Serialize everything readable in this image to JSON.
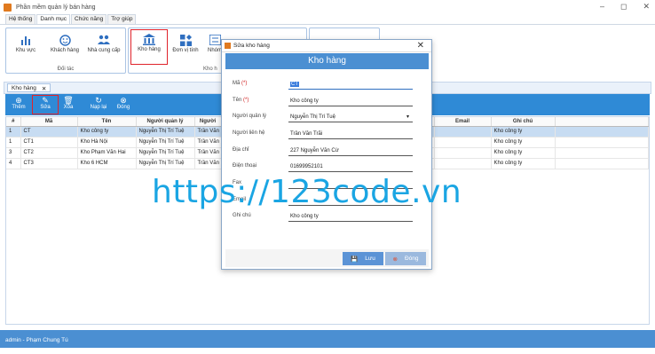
{
  "window": {
    "title": "Phần mềm quản lý bán hàng",
    "ctrls": [
      "–",
      "◻",
      "✕"
    ]
  },
  "menu": [
    "Hệ thống",
    "Danh mục",
    "Chức năng",
    "Trợ giúp"
  ],
  "ribbon": {
    "group1": {
      "label": "Đối tác",
      "buttons": [
        "Khu vực",
        "Khách hàng",
        "Nhà cung cấp"
      ]
    },
    "group2": {
      "label": "Kho h",
      "buttons": [
        "Kho hàng",
        "Đơn vị tính",
        "Nhóm"
      ]
    }
  },
  "doctab": {
    "label": "Kho hàng",
    "close": "✕"
  },
  "toolbar": {
    "add": "Thêm",
    "edit": "Sửa",
    "delete": "Xóa",
    "reload": "Nạp lại",
    "close": "Đóng"
  },
  "grid": {
    "columns": [
      "#",
      "Mã",
      "Tên",
      "Người quản lý",
      "Người",
      "",
      "",
      "Email",
      "Ghi chú"
    ],
    "rows": [
      {
        "n": "1",
        "ma": "CT",
        "ten": "Kho công ty",
        "ql": "Nguyễn Thị Trí Tuệ",
        "nl": "Trần Văn",
        "ghichu": "Kho công ty"
      },
      {
        "n": "1",
        "ma": "CT1",
        "ten": "Kho Hà Nội",
        "ql": "Nguyễn Thị Trí Tuệ",
        "nl": "Trần Văn",
        "ghichu": "Kho công ty"
      },
      {
        "n": "3",
        "ma": "CT2",
        "ten": "Kho Phạm Văn Hai",
        "ql": "Nguyễn Thị Trí Tuệ",
        "nl": "Trần Văn",
        "ghichu": "Kho công ty"
      },
      {
        "n": "4",
        "ma": "CT3",
        "ten": "Kho 6 HCM",
        "ql": "Nguyễn Thị Trí Tuệ",
        "nl": "Trần Văn",
        "ghichu": "Kho công ty"
      }
    ]
  },
  "dialog": {
    "title": "Sửa kho hàng",
    "header": "Kho hàng",
    "fields": {
      "ma": {
        "label": "Mã",
        "req": "(*)",
        "value": "CT"
      },
      "ten": {
        "label": "Tên",
        "req": "(*)",
        "value": "Kho công ty"
      },
      "ql": {
        "label": "Người quản lý",
        "value": "Nguyễn Thị Trí Tuệ"
      },
      "lh": {
        "label": "Người liên hệ",
        "value": "Trần Văn Trãi"
      },
      "dc": {
        "label": "Địa chỉ",
        "value": "227 Nguyễn Văn Cừ"
      },
      "dt": {
        "label": "Điện thoại",
        "value": "01699952101"
      },
      "fax": {
        "label": "Fax",
        "value": ""
      },
      "email": {
        "label": "Email",
        "value": ""
      },
      "gc": {
        "label": "Ghi chú",
        "value": "Kho công ty"
      }
    },
    "save": "Lưu",
    "close": "Đóng"
  },
  "watermark": "https://123code.vn",
  "status": "admin - Phạm Chung Tú"
}
